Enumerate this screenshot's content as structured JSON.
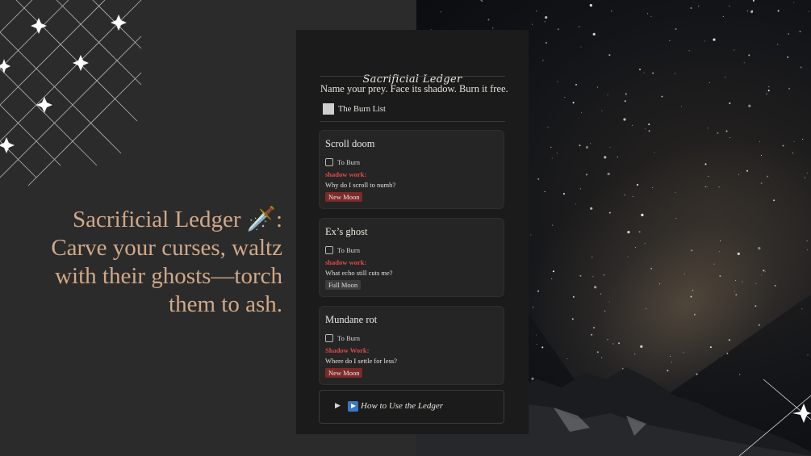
{
  "hero": {
    "line1": "Sacrificial Ledger",
    "dagger": "🗡️",
    "colon": ":",
    "line2": "Carve your curses, waltz",
    "line3": "with their ghosts—torch",
    "line4": "them to ash."
  },
  "app": {
    "title": "Sacrificial Ledger",
    "tagline": "Name your prey. Face its shadow. Burn it free.",
    "burn_list_label": "The Burn List"
  },
  "entries": [
    {
      "name": "Scroll doom",
      "checkbox_label": "To Burn",
      "shadow_label": "shadow work:",
      "question": "Why do I scroll to numb?",
      "moon": "New Moon"
    },
    {
      "name": "Ex’s ghost",
      "checkbox_label": "To Burn",
      "shadow_label": "shadow work:",
      "question": "What echo still cuts me?",
      "moon": "Full Moon"
    },
    {
      "name": "Mundane rot",
      "checkbox_label": "To Burn",
      "shadow_label": "Shadow Work:",
      "question": "Where do I settle for less?",
      "moon": "New Moon"
    }
  ],
  "howto": {
    "label": "How to Use the Ledger"
  },
  "colors": {
    "accent_gold": "#cfa98a",
    "shadow_red": "#e04848",
    "new_moon_badge": "#7a2a2a",
    "full_moon_badge": "#3d3d3d"
  }
}
